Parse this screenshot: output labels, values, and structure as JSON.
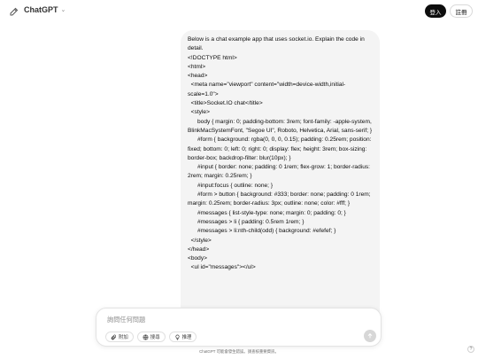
{
  "header": {
    "model_name": "ChatGPT",
    "login_label": "登入",
    "signup_label": "註冊"
  },
  "message": {
    "lines": [
      "Below is a chat example app that uses socket.io. Explain the code in detail.",
      "",
      "<!DOCTYPE html>",
      "<html>",
      "<head>",
      "  <meta name=\"viewport\" content=\"width=device-width,initial-scale=1.0\">",
      "  <title>Socket.IO chat</title>",
      "  <style>",
      "      body { margin: 0; padding-bottom: 3rem; font-family: -apple-system, BlinkMacSystemFont, \"Segoe UI\", Roboto, Helvetica, Arial, sans-serif; }",
      "",
      "      #form { background: rgba(0, 0, 0, 0.15); padding: 0.25rem; position: fixed; bottom: 0; left: 0; right: 0; display: flex; height: 3rem; box-sizing: border-box; backdrop-filter: blur(10px); }",
      "      #input { border: none; padding: 0 1rem; flex-grow: 1; border-radius: 2rem; margin: 0.25rem; }",
      "      #input:focus { outline: none; }",
      "      #form > button { background: #333; border: none; padding: 0 1rem; margin: 0.25rem; border-radius: 3px; outline: none; color: #fff; }",
      "",
      "      #messages { list-style-type: none; margin: 0; padding: 0; }",
      "      #messages > li { padding: 0.5rem 1rem; }",
      "      #messages > li:nth-child(odd) { background: #efefef; }",
      "  </style>",
      "</head>",
      "<body>",
      "  <ul id=\"messages\"></ul>"
    ]
  },
  "composer": {
    "placeholder": "詢問任何問題",
    "attach_label": "附加",
    "search_label": "搜尋",
    "reason_label": "推理"
  },
  "footer": {
    "disclaimer": "ChatGPT 可能會發生錯誤。請查核重要資訊。",
    "help": "?"
  },
  "icons": {
    "new_chat": "edit-icon",
    "model_dropdown": "chevron-down-icon",
    "attach": "paperclip-icon",
    "search": "globe-icon",
    "reason": "lightbulb-icon",
    "send": "arrow-up-icon"
  },
  "colors": {
    "user_bubble": "#f4f4f4",
    "login_button": "#0d0d0d",
    "send_button_disabled": "#d7d7d7"
  }
}
